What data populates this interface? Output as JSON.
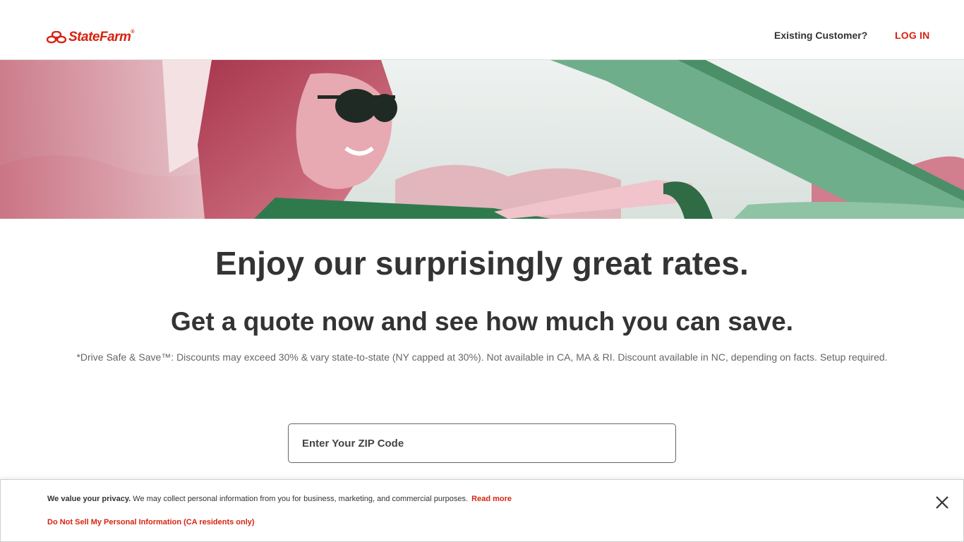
{
  "header": {
    "logo_text": "StateFarm",
    "logo_tm": "®",
    "existing_customer": "Existing Customer?",
    "login_label": "LOG IN"
  },
  "hero": {
    "image_icon": "woman-driving-convertible-image"
  },
  "main": {
    "headline": "Enjoy our surprisingly great rates.",
    "subheadline": "Get a quote now and see how much you can save.",
    "disclaimer": "*Drive Safe & Save™: Discounts may exceed 30% & vary state-to-state (NY capped at 30%). Not available in CA, MA & RI. Discount available in NC, depending on facts. Setup required.",
    "zip_placeholder": "Enter Your ZIP Code",
    "zip_value": ""
  },
  "privacy": {
    "bold_lead": "We value your privacy.",
    "body": " We may collect personal information from you for business, marketing, and commercial purposes.",
    "read_more": "Read more",
    "do_not_sell": "Do Not Sell My Personal Information (CA residents only)",
    "close_icon": "close-icon"
  },
  "colors": {
    "brand_red": "#d62311",
    "text_dark": "#333333",
    "text_muted": "#666666",
    "border": "#e1e1e1"
  }
}
